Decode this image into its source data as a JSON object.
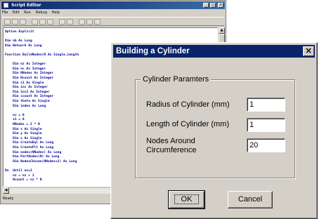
{
  "editor": {
    "title": "Script Editor",
    "title_buttons": [
      "_",
      "□",
      "×"
    ],
    "menu": [
      "File",
      "Edit",
      "Run",
      "Debug",
      "Help"
    ],
    "code_lines": [
      "Option Explicit",
      "",
      "Dim nb As Long",
      "Dim Network As Long",
      "",
      "Function BuildNodes(R As Single,Length",
      "",
      "    Dim nz As Integer",
      "    Dim nc As Integer",
      "    Dim NNodes As Integer",
      "    Dim Ncount As Integer",
      "    Dim z1 As Single",
      "    Dim inc As Integer",
      "    Dim inc2 As Integer",
      "    Dim ccount As Integer",
      "    Dim theta As Single",
      "    Dim index As Long",
      "",
      "    nc = 0",
      "    z1 = 0",
      "    NNodes = 2 * N",
      "    Dim x As Single",
      "    Dim y As Single",
      "    Dim z As Single",
      "    Dim CreateEql As Long",
      "    Dim CreatePlt As Long",
      "    Dim nodes(NNodes) As Long",
      "    Dim PartNodes(N) As Long",
      "    Dim NodesChosen(NNodes+2) As Long",
      "",
      "Do  Until nz=2",
      "    nz = nz + 1",
      "    Ncount = nz * N"
    ],
    "status": "Ready"
  },
  "dialog": {
    "title": "Building a Cylinder",
    "close_label": "×",
    "group_title": "Cylinder Paramters",
    "fields": [
      {
        "label": "Radius of Cylinder (mm)",
        "value": "1"
      },
      {
        "label": "Length of Cylinder (mm)",
        "value": "1"
      },
      {
        "label": "Nodes Around\nCircumference",
        "value": "20"
      }
    ],
    "ok_label": "OK",
    "cancel_label": "Cancel"
  }
}
